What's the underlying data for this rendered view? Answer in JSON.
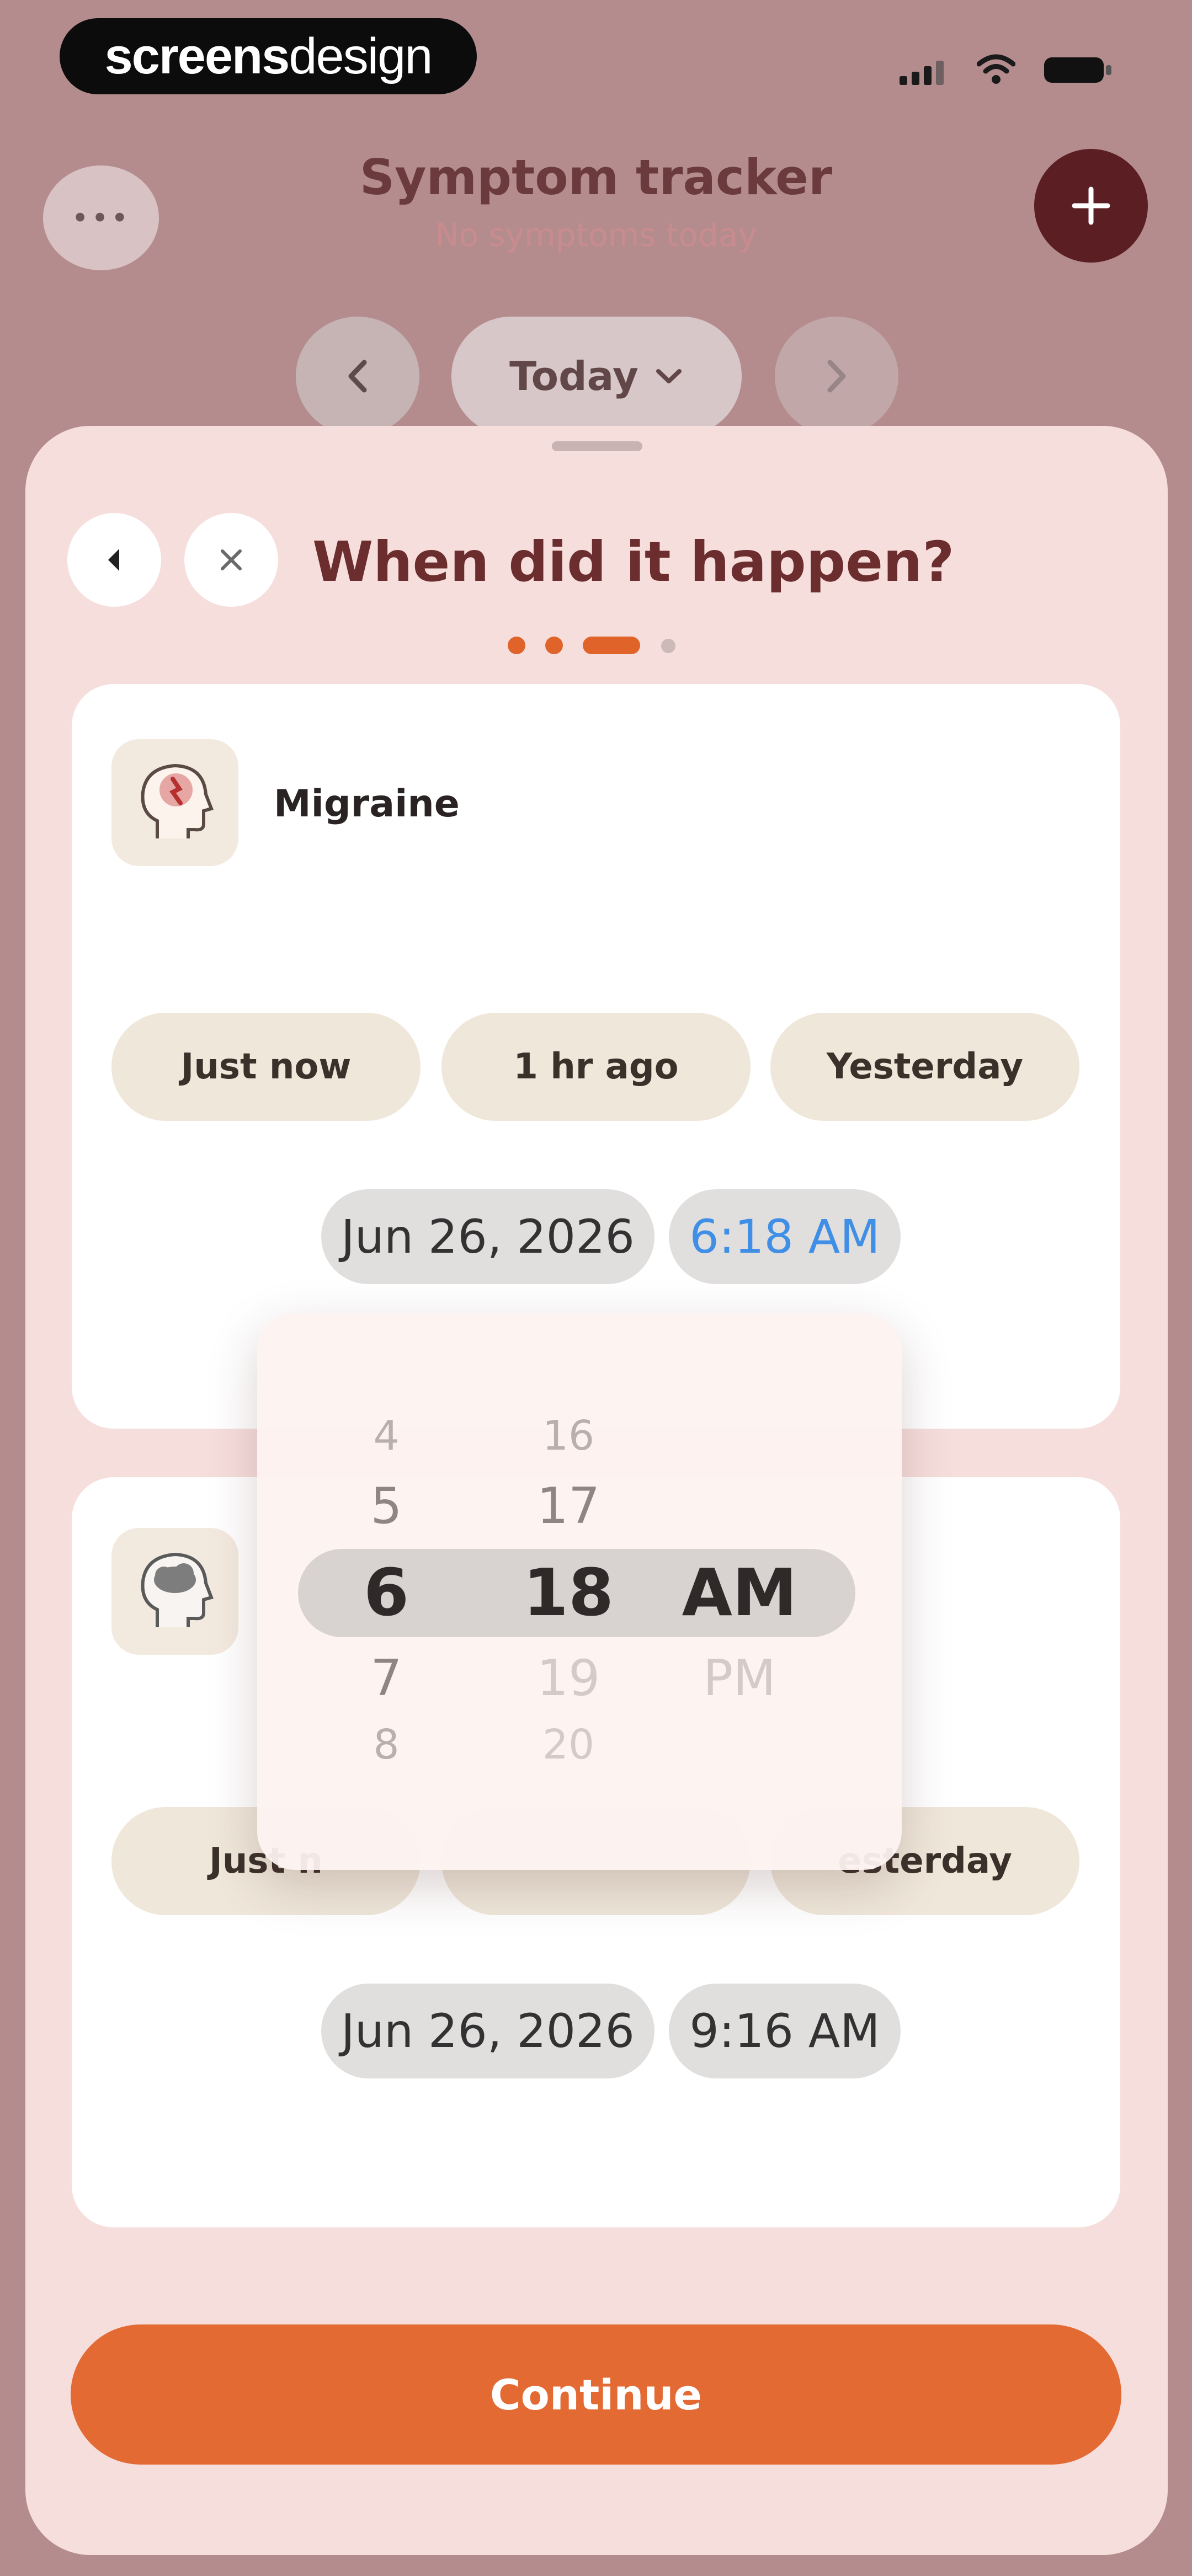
{
  "status_bar": {
    "brand_part1": "screens",
    "brand_part2": "design"
  },
  "header": {
    "title": "Symptom tracker",
    "subtitle": "No symptoms today",
    "more_icon": "ellipsis-icon",
    "add_icon": "plus-icon"
  },
  "date_nav": {
    "current_label": "Today",
    "prev_icon": "chevron-left-icon",
    "next_icon": "chevron-right-icon"
  },
  "sheet": {
    "question": "When did it happen?",
    "progress": {
      "total_steps": 4,
      "current_step": 3
    }
  },
  "symptoms": [
    {
      "name": "Migraine",
      "icon": "head-migraine-icon",
      "quick_options": [
        "Just now",
        "1 hr ago",
        "Yesterday"
      ],
      "date": "Jun 26, 2026",
      "time": "6:18 AM"
    },
    {
      "name": "",
      "icon": "head-fog-icon",
      "quick_options": [
        "Just n",
        "",
        "esterday"
      ],
      "date": "Jun 26, 2026",
      "time": "9:16 AM"
    }
  ],
  "time_picker": {
    "hours": [
      "4",
      "5",
      "6",
      "7",
      "8"
    ],
    "minutes": [
      "16",
      "17",
      "18",
      "19",
      "20"
    ],
    "periods": [
      "AM",
      "PM"
    ]
  },
  "footer": {
    "continue_label": "Continue"
  },
  "colors": {
    "accent": "#e36a33",
    "title": "#6b2d2d",
    "add_button": "#5a1e23",
    "sheet": "#f6dedc",
    "link_blue": "#3f8fe6"
  }
}
